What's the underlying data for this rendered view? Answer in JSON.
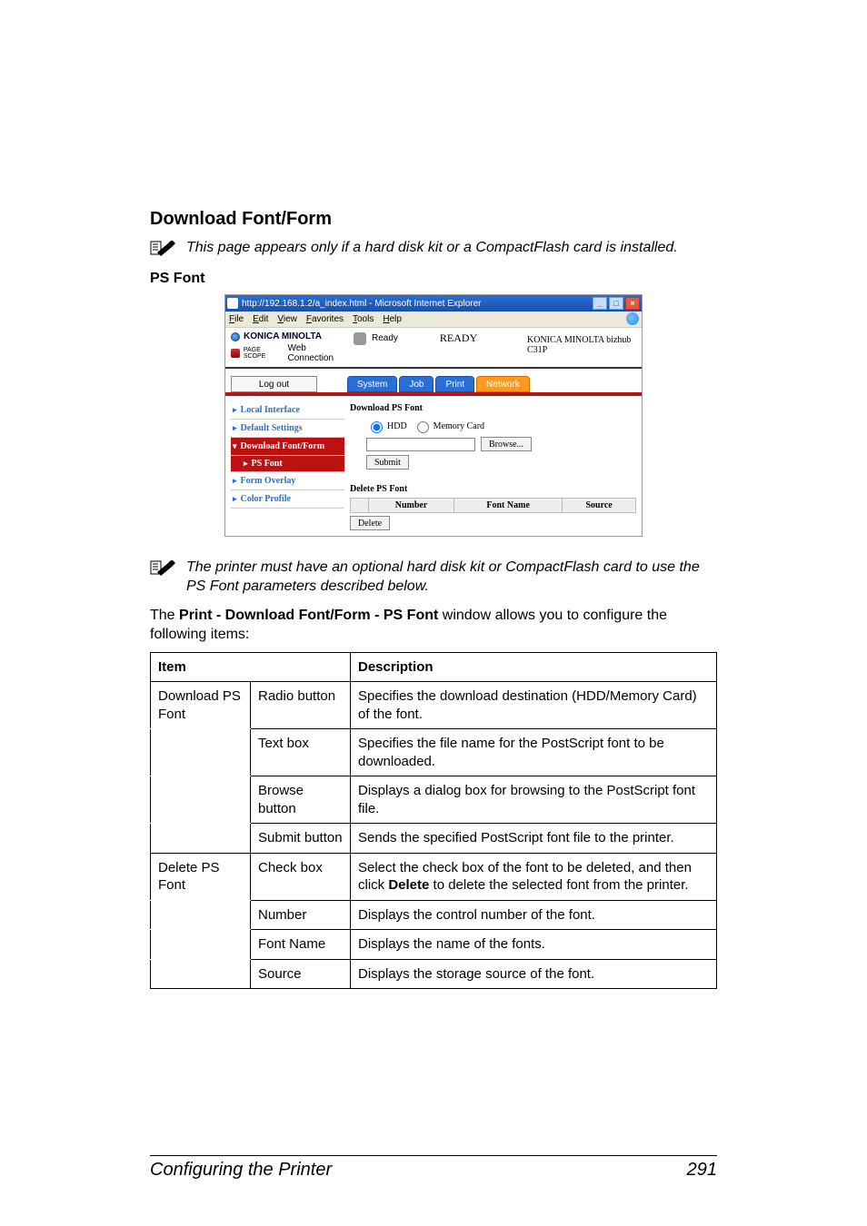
{
  "section_title": "Download Font/Form",
  "note1": "This page appears only if a hard disk kit or a CompactFlash card is installed.",
  "sub_title": "PS Font",
  "note2": "The printer must have an optional hard disk kit or CompactFlash card to use the PS Font parameters described below.",
  "intro": {
    "pre": "The ",
    "bold": "Print - Download Font/Form - PS Font",
    "post": " window allows you to configure the following items:"
  },
  "screenshot": {
    "title": "http://192.168.1.2/a_index.html - Microsoft Internet Explorer",
    "menus": [
      "File",
      "Edit",
      "View",
      "Favorites",
      "Tools",
      "Help"
    ],
    "brand": "KONICA MINOLTA",
    "brand_sub_a": "PAGE SCOPE",
    "brand_sub_b": "Web Connection",
    "ready_small": "Ready",
    "ready_big": "READY",
    "model_a": "KONICA MINOLTA bizhub",
    "model_b": "C31P",
    "logout": "Log out",
    "tabs": {
      "system": "System",
      "job": "Job",
      "print": "Print",
      "network": "Network"
    },
    "sidebar": {
      "local_interface": "Local Interface",
      "default_settings": "Default Settings",
      "download_font_form": "Download Font/Form",
      "ps_font": "PS Font",
      "form_overlay": "Form Overlay",
      "color_profile": "Color Profile"
    },
    "main": {
      "dl_title": "Download PS Font",
      "hdd": "HDD",
      "memcard": "Memory Card",
      "browse": "Browse...",
      "submit": "Submit",
      "del_title": "Delete PS Font",
      "col_number": "Number",
      "col_font_name": "Font Name",
      "col_source": "Source",
      "delete": "Delete"
    }
  },
  "table": {
    "h_item": "Item",
    "h_desc": "Description",
    "r1c1": "Download PS Font",
    "r1c2": "Radio button",
    "r1c3": "Specifies the download destination (HDD/Memory Card) of the font.",
    "r2c2": "Text box",
    "r2c3": "Specifies the file name for the PostScript font to be downloaded.",
    "r3c2": "Browse button",
    "r3c3": "Displays a dialog box for browsing to the PostScript font file.",
    "r4c2": "Submit button",
    "r4c3": "Sends the specified PostScript font file to the printer.",
    "r5c1": "Delete PS Font",
    "r5c2": "Check box",
    "r5c3_a": "Select the check box of the font to be deleted, and then click ",
    "r5c3_b": "Delete",
    "r5c3_c": " to delete the selected font from the printer.",
    "r6c2": "Number",
    "r6c3": "Displays the control number of the font.",
    "r7c2": "Font Name",
    "r7c3": "Displays the name of the fonts.",
    "r8c2": "Source",
    "r8c3": "Displays the storage source of the font."
  },
  "footer_left": "Configuring the Printer",
  "footer_right": "291"
}
